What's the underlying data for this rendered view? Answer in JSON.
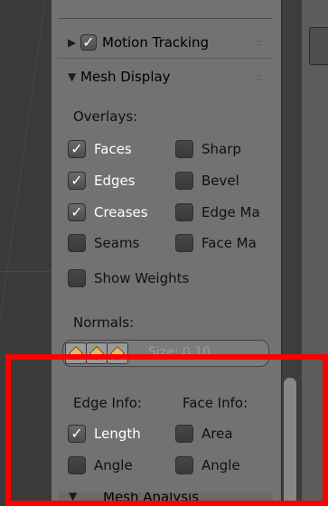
{
  "panels": {
    "motion_tracking": {
      "label": "Motion Tracking",
      "checked": true,
      "grip": ":::"
    },
    "mesh_display": {
      "label": "Mesh Display",
      "grip": ":::"
    },
    "mesh_analysis": {
      "label": "Mesh Analysis"
    }
  },
  "overlays": {
    "label": "Overlays:",
    "items": [
      {
        "label": "Faces",
        "checked": true
      },
      {
        "label": "Sharp",
        "checked": false
      },
      {
        "label": "Edges",
        "checked": true
      },
      {
        "label": "Bevel",
        "checked": false
      },
      {
        "label": "Creases",
        "checked": true
      },
      {
        "label": "Edge Ma",
        "checked": false
      },
      {
        "label": "Seams",
        "checked": false
      },
      {
        "label": "Face Ma",
        "checked": false
      }
    ],
    "show_weights": {
      "label": "Show Weights",
      "checked": false
    }
  },
  "normals": {
    "label": "Normals:",
    "size_text": "Size: 0.10"
  },
  "edge_info": {
    "label": "Edge Info:",
    "items": [
      {
        "label": "Length",
        "checked": true
      },
      {
        "label": "Angle",
        "checked": false
      }
    ]
  },
  "face_info": {
    "label": "Face Info:",
    "items": [
      {
        "label": "Area",
        "checked": false
      },
      {
        "label": "Angle",
        "checked": false
      }
    ]
  },
  "colors": {
    "panel_bg": "#727272",
    "highlight_border": "#ff0000",
    "checkbox_bg": "#3f3f3f"
  }
}
